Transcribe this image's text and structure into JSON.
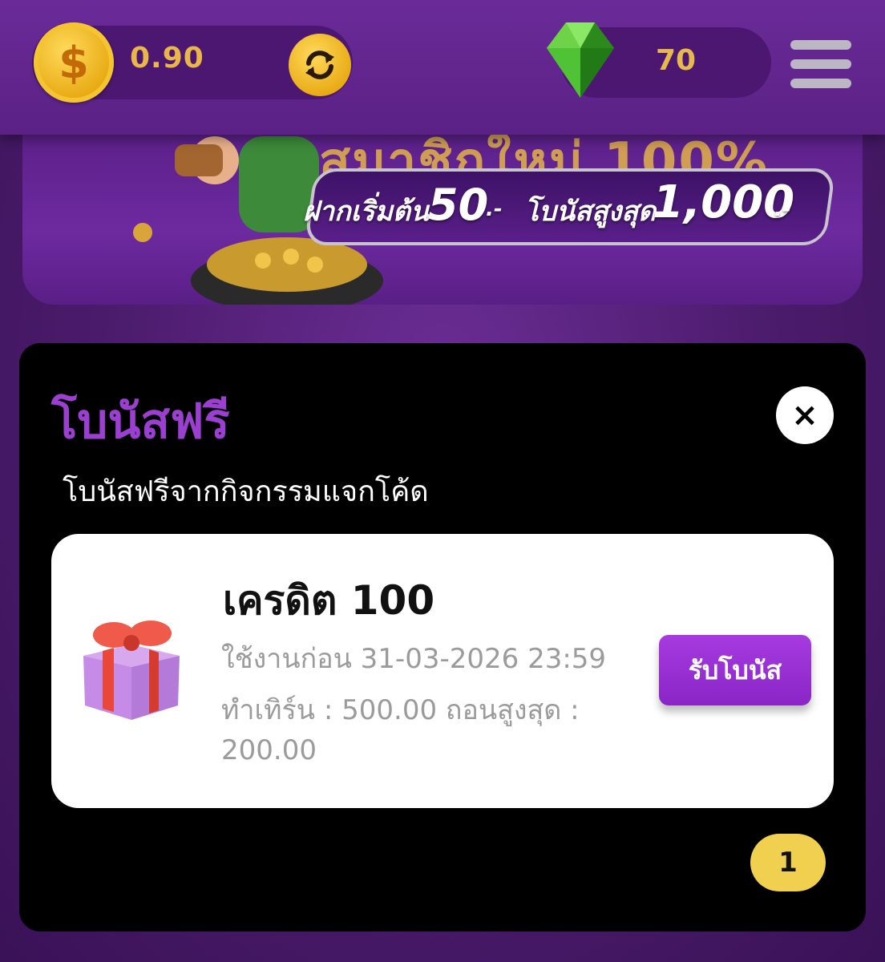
{
  "header": {
    "balance": "0.90",
    "gems": "70",
    "coin_symbol": "$"
  },
  "banner": {
    "headline": "สมาชิกใหม่ 100%",
    "deposit_label": "ฝากเริ่มต้น",
    "deposit_value": "50",
    "deposit_suffix": ".-",
    "max_bonus_label": "โบนัสสูงสุด",
    "max_bonus_value": "1,000",
    "max_bonus_suffix": ".-"
  },
  "modal": {
    "title": "โบนัสฟรี",
    "close_symbol": "×",
    "subtitle": "โบนัสฟรีจากกิจกรรมแจกโค้ด",
    "card": {
      "title": "เครดิต 100",
      "expiry": "ใช้งานก่อน 31-03-2026 23:59",
      "turnover_line": "ทำเทิร์น : 500.00 ถอนสูงสุด :",
      "max_withdraw": "200.00",
      "claim_label": "รับโบนัส"
    },
    "page_number": "1"
  },
  "colors": {
    "background": "#4a1a6e",
    "accent_purple": "#9a3fd0",
    "gold": "#e9b64a",
    "badge_yellow": "#f1cf4f"
  },
  "icons": [
    "coin-icon",
    "refresh-icon",
    "gem-icon",
    "hamburger-menu-icon",
    "close-icon",
    "gift-icon"
  ]
}
